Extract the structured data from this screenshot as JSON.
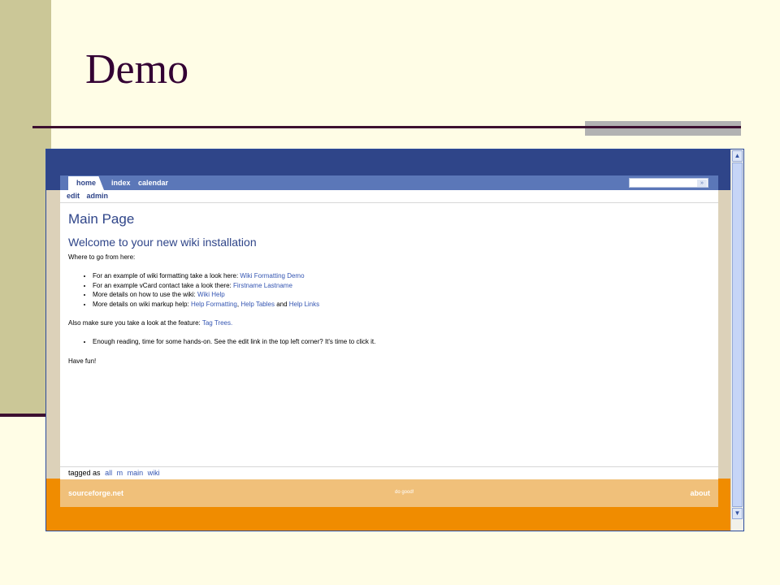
{
  "slide": {
    "title": "Demo"
  },
  "wiki": {
    "tabs": {
      "home": "home",
      "index": "index",
      "calendar": "calendar"
    },
    "search": {
      "button_glyph": "»"
    },
    "subnav": {
      "edit": "edit",
      "admin": "admin"
    },
    "page_title": "Main Page",
    "welcome_heading": "Welcome to your new wiki installation",
    "intro": "Where to go from here:",
    "bullets": [
      {
        "text": "For an example of wiki formatting take a look here: ",
        "link": "Wiki Formatting Demo"
      },
      {
        "text": "For an example vCard contact take a look there: ",
        "link": "Firstname Lastname"
      },
      {
        "text": "More details on how to use the wiki: ",
        "link": "Wiki Help"
      },
      {
        "text": "More details on wiki markup help: ",
        "link1": "Help Formatting",
        "sep1": ", ",
        "link2": "Help Tables",
        "sep2": " and ",
        "link3": "Help Links"
      }
    ],
    "feature_text": "Also make sure you take a look at the feature: ",
    "feature_link": "Tag Trees.",
    "hands_on": "Enough reading, time for some hands-on. See the edit link in the top left corner? It's time to click it.",
    "have_fun": "Have fun!",
    "tags_label": "tagged as",
    "tags": [
      "all",
      "m",
      "main",
      "wiki"
    ],
    "footer": {
      "left": "sourceforge.net",
      "middle": "do good!",
      "right": "about"
    }
  },
  "scrollbar": {
    "up": "▲",
    "down": "▼"
  }
}
